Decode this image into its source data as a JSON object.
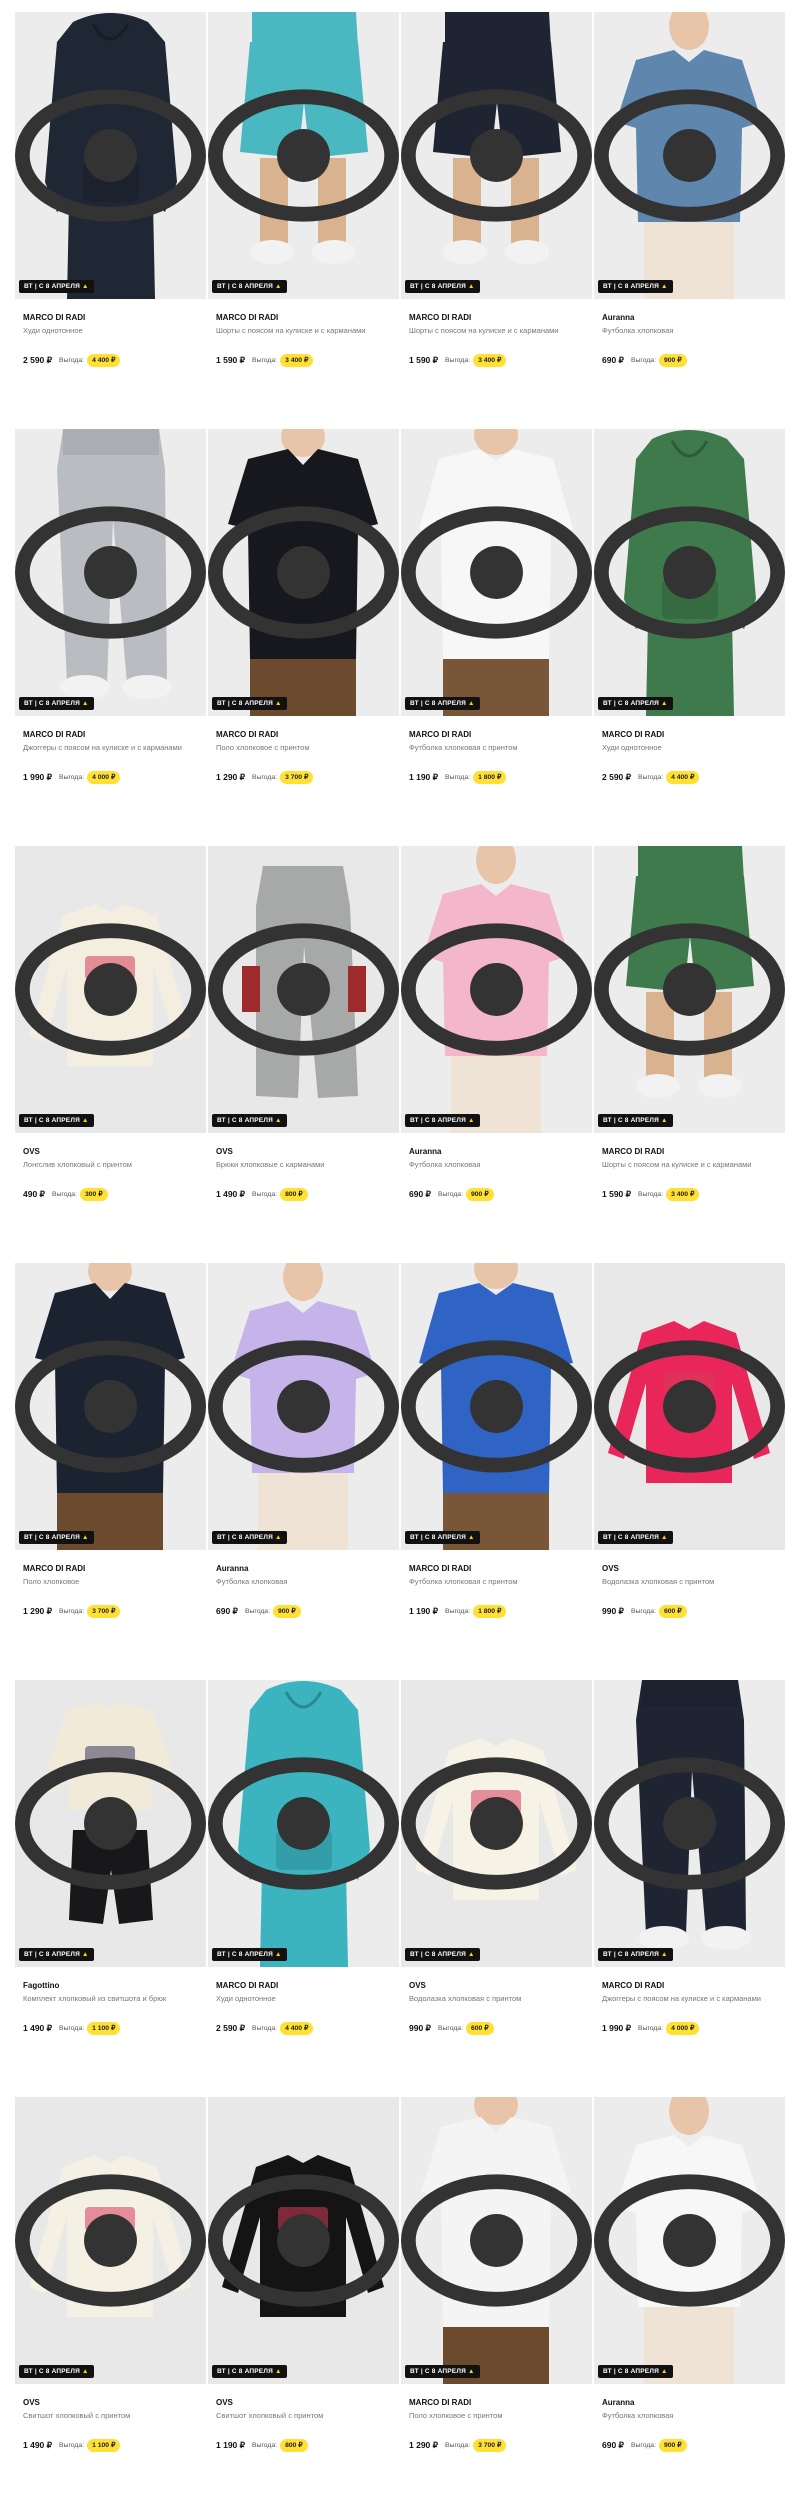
{
  "badge_label": "ВТ | С 8 АПРЕЛЯ",
  "badge_icon": "fire-icon",
  "save_label": "Выгода:",
  "currency": "₽",
  "colors": {
    "badge_bg": "#111111",
    "chip_bg": "#ffe033",
    "muted": "#777777"
  },
  "products": [
    {
      "brand": "MARCO DI RADI",
      "name": "Худи однотонное",
      "price": "2 590 ₽",
      "saving": "4 400 ₽",
      "color": "#1f2634",
      "kind": "hoodie",
      "bg": "#ececec"
    },
    {
      "brand": "MARCO DI RADI",
      "name": "Шорты с поясом на кулиске и с карманами",
      "price": "1 590 ₽",
      "saving": "3 400 ₽",
      "color": "#4ab8c1",
      "kind": "shorts",
      "bg": "#ececec"
    },
    {
      "brand": "MARCO DI RADI",
      "name": "Шорты с поясом на кулиске и с карманами",
      "price": "1 590 ₽",
      "saving": "3 400 ₽",
      "color": "#1e2432",
      "kind": "shorts",
      "bg": "#ececec"
    },
    {
      "brand": "Auranna",
      "name": "Футболка хлопковая",
      "price": "690 ₽",
      "saving": "900 ₽",
      "color": "#5f87ad",
      "kind": "tee-woman",
      "bg": "#ececec"
    },
    {
      "brand": "MARCO DI RADI",
      "name": "Джоггеры с поясом на кулиске и с карманами",
      "price": "1 990 ₽",
      "saving": "4 000 ₽",
      "color": "#b9bcc0",
      "kind": "pants",
      "bg": "#ececec"
    },
    {
      "brand": "MARCO DI RADI",
      "name": "Поло хлопковое с принтом",
      "price": "1 290 ₽",
      "saving": "3 700 ₽",
      "color": "#16181d",
      "kind": "polo",
      "bg": "#ececec"
    },
    {
      "brand": "MARCO DI RADI",
      "name": "Футболка хлопковая с принтом",
      "price": "1 190 ₽",
      "saving": "1 800 ₽",
      "color": "#f7f7f7",
      "kind": "tee-man",
      "bg": "#ececec"
    },
    {
      "brand": "MARCO DI RADI",
      "name": "Худи однотонное",
      "price": "2 590 ₽",
      "saving": "4 400 ₽",
      "color": "#3e7a4c",
      "kind": "hoodie",
      "bg": "#ececec"
    },
    {
      "brand": "OVS",
      "name": "Лонгслив хлопковый с принтом",
      "price": "490 ₽",
      "saving": "300 ₽",
      "color": "#f3eedf",
      "kind": "flat-longsleeve",
      "bg": "#e8e8e8"
    },
    {
      "brand": "OVS",
      "name": "Брюки хлопковые с карманами",
      "price": "1 490 ₽",
      "saving": "800 ₽",
      "color": "#a7a8a8",
      "kind": "flat-pants",
      "bg": "#e8e8e8"
    },
    {
      "brand": "Auranna",
      "name": "Футболка хлопковая",
      "price": "690 ₽",
      "saving": "900 ₽",
      "color": "#f3b6cb",
      "kind": "tee-woman",
      "bg": "#ececec"
    },
    {
      "brand": "MARCO DI RADI",
      "name": "Шорты с поясом на кулиске и с карманами",
      "price": "1 590 ₽",
      "saving": "3 400 ₽",
      "color": "#3e7a4c",
      "kind": "shorts",
      "bg": "#ececec"
    },
    {
      "brand": "MARCO DI RADI",
      "name": "Поло хлопковое",
      "price": "1 290 ₽",
      "saving": "3 700 ₽",
      "color": "#1b2230",
      "kind": "polo",
      "bg": "#ececec"
    },
    {
      "brand": "Auranna",
      "name": "Футболка хлопковая",
      "price": "690 ₽",
      "saving": "900 ₽",
      "color": "#c5b3ea",
      "kind": "tee-woman",
      "bg": "#ececec"
    },
    {
      "brand": "MARCO DI RADI",
      "name": "Футболка хлопковая с принтом",
      "price": "1 190 ₽",
      "saving": "1 800 ₽",
      "color": "#2f63c4",
      "kind": "tee-man",
      "bg": "#ececec"
    },
    {
      "brand": "OVS",
      "name": "Водолазка хлопковая с принтом",
      "price": "990 ₽",
      "saving": "600 ₽",
      "color": "#e8265a",
      "kind": "flat-longsleeve",
      "bg": "#e8e8e8"
    },
    {
      "brand": "Fagottino",
      "name": "Комплект хлопковый из свитшота и брюк",
      "price": "1 490 ₽",
      "saving": "1 100 ₽",
      "color": "#f2ead8",
      "kind": "flat-set",
      "bg": "#e8e8e8"
    },
    {
      "brand": "MARCO DI RADI",
      "name": "Худи однотонное",
      "price": "2 590 ₽",
      "saving": "4 400 ₽",
      "color": "#3bb4c0",
      "kind": "hoodie",
      "bg": "#ececec"
    },
    {
      "brand": "OVS",
      "name": "Водолазка хлопковая с принтом",
      "price": "990 ₽",
      "saving": "600 ₽",
      "color": "#f6f2e6",
      "kind": "flat-longsleeve",
      "bg": "#e8e8e8"
    },
    {
      "brand": "MARCO DI RADI",
      "name": "Джоггеры с поясом на кулиске и с карманами",
      "price": "1 990 ₽",
      "saving": "4 000 ₽",
      "color": "#1e2432",
      "kind": "pants",
      "bg": "#ececec"
    },
    {
      "brand": "OVS",
      "name": "Свитшот хлопковый с принтом",
      "price": "1 490 ₽",
      "saving": "1 100 ₽",
      "color": "#f5f0e4",
      "kind": "flat-longsleeve",
      "bg": "#e8e8e8"
    },
    {
      "brand": "OVS",
      "name": "Свитшот хлопковый с принтом",
      "price": "1 190 ₽",
      "saving": "800 ₽",
      "color": "#141414",
      "kind": "flat-longsleeve",
      "bg": "#e8e8e8"
    },
    {
      "brand": "MARCO DI RADI",
      "name": "Поло хлопковое с принтом",
      "price": "1 290 ₽",
      "saving": "3 700 ₽",
      "color": "#f4f4f4",
      "kind": "polo",
      "bg": "#ececec"
    },
    {
      "brand": "Auranna",
      "name": "Футболка хлопковая",
      "price": "690 ₽",
      "saving": "900 ₽",
      "color": "#f7f7f7",
      "kind": "tee-woman",
      "bg": "#ececec"
    }
  ]
}
